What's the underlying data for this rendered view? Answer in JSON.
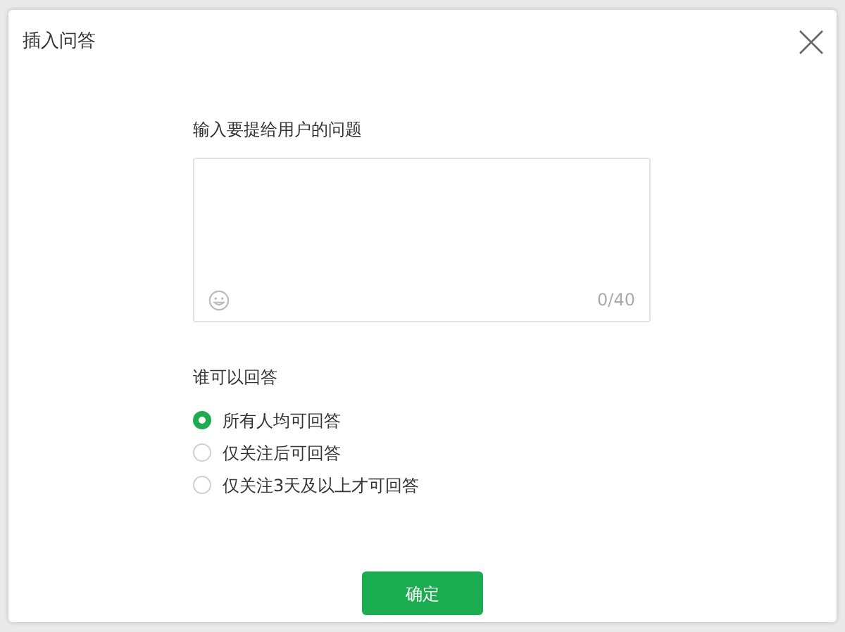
{
  "window": {
    "title": "插入问答"
  },
  "question": {
    "label": "输入要提给用户的问题",
    "counter": "0/40"
  },
  "audience": {
    "label": "谁可以回答",
    "options": [
      {
        "label": "所有人均可回答",
        "selected": true
      },
      {
        "label": "仅关注后可回答",
        "selected": false
      },
      {
        "label": "仅关注3天及以上才可回答",
        "selected": false
      }
    ]
  },
  "buttons": [
    "确定"
  ]
}
